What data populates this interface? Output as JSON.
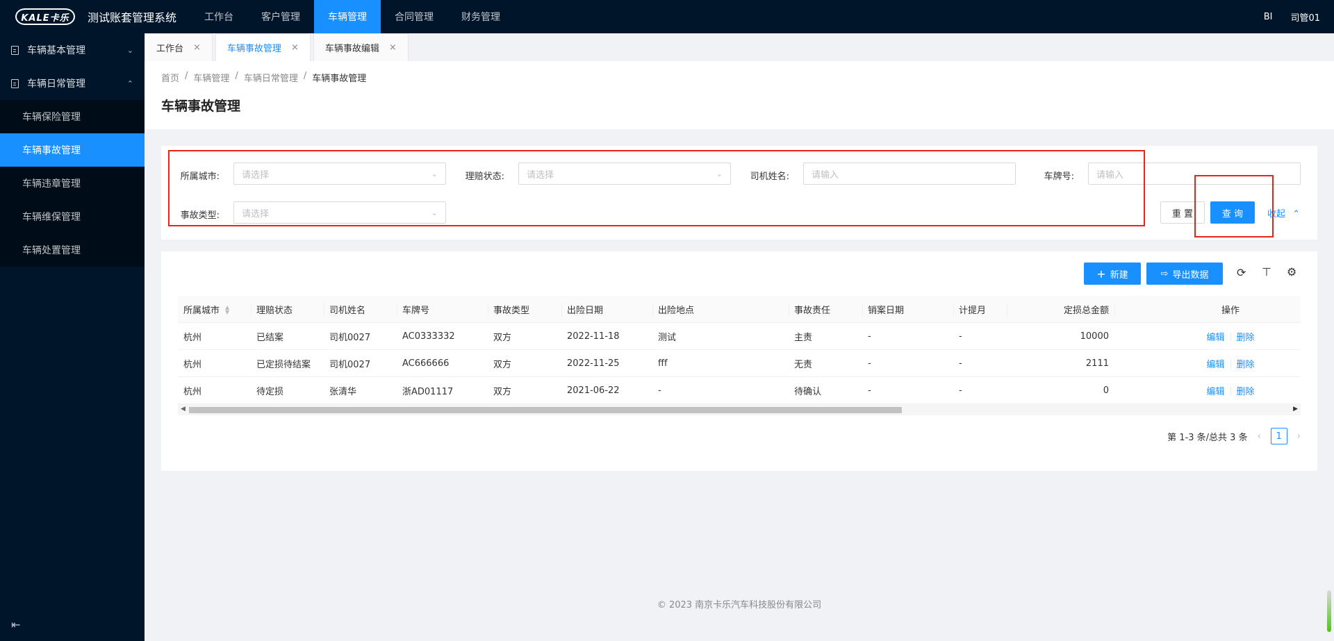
{
  "app": {
    "logo_text": "KALE卡乐",
    "title": "测试账套管理系统",
    "nav": [
      {
        "label": "工作台"
      },
      {
        "label": "客户管理"
      },
      {
        "label": "车辆管理"
      },
      {
        "label": "合同管理"
      },
      {
        "label": "财务管理"
      }
    ],
    "bi_label": "BI",
    "user_name": "司管01"
  },
  "sidebar": {
    "groups": [
      {
        "label": "车辆基本管理"
      },
      {
        "label": "车辆日常管理"
      }
    ],
    "items": [
      {
        "label": "车辆保险管理"
      },
      {
        "label": "车辆事故管理"
      },
      {
        "label": "车辆违章管理"
      },
      {
        "label": "车辆维保管理"
      },
      {
        "label": "车辆处置管理"
      }
    ]
  },
  "tabs": [
    {
      "label": "工作台"
    },
    {
      "label": "车辆事故管理"
    },
    {
      "label": "车辆事故编辑"
    }
  ],
  "breadcrumb": [
    "首页",
    "车辆管理",
    "车辆日常管理",
    "车辆事故管理"
  ],
  "page_title": "车辆事故管理",
  "filters": {
    "city": {
      "label": "所属城市:",
      "placeholder": "请选择"
    },
    "claim_status": {
      "label": "理赔状态:",
      "placeholder": "请选择"
    },
    "driver_name": {
      "label": "司机姓名:",
      "placeholder": "请输入"
    },
    "plate": {
      "label": "车牌号:",
      "placeholder": "请输入"
    },
    "accident_type": {
      "label": "事故类型:",
      "placeholder": "请选择"
    },
    "reset_label": "重 置",
    "query_label": "查 询",
    "collapse_label": "收起"
  },
  "toolbar": {
    "new_label": "新建",
    "export_label": "导出数据"
  },
  "table": {
    "columns": [
      "所属城市",
      "理赔状态",
      "司机姓名",
      "车牌号",
      "事故类型",
      "出险日期",
      "出险地点",
      "事故责任",
      "销案日期",
      "计提月",
      "定损总金额",
      "操作"
    ],
    "rows": [
      [
        "杭州",
        "已结案",
        "司机0027",
        "AC0333332",
        "双方",
        "2022-11-18",
        "测试",
        "主责",
        "-",
        "-",
        "10000"
      ],
      [
        "杭州",
        "已定损待结案",
        "司机0027",
        "AC666666",
        "双方",
        "2022-11-25",
        "fff",
        "无责",
        "-",
        "-",
        "2111"
      ],
      [
        "杭州",
        "待定损",
        "张清华",
        "浙AD01117",
        "双方",
        "2021-06-22",
        "-",
        "待确认",
        "-",
        "-",
        "0"
      ]
    ],
    "edit_label": "编辑",
    "delete_label": "删除"
  },
  "pagination": {
    "summary": "第 1-3 条/总共 3 条",
    "current_page": "1"
  },
  "footer": "© 2023 南京卡乐汽车科技股份有限公司"
}
